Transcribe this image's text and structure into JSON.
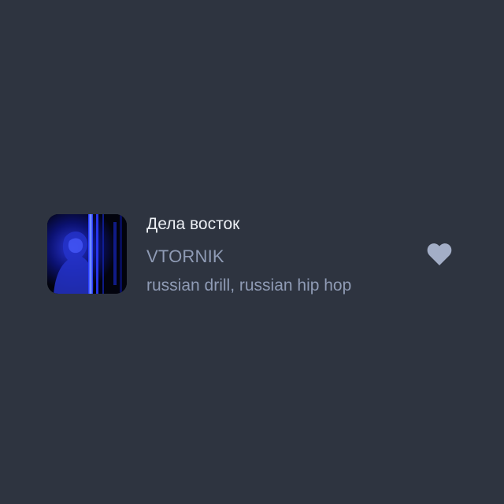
{
  "track": {
    "title": "Дела восток",
    "artist": "VTORNIK",
    "genres": "russian drill, russian hip hop",
    "cover_icon": "album-cover-image",
    "like_icon": "heart-icon",
    "like_color": "#a3aec7"
  },
  "colors": {
    "background": "#2e3440",
    "title": "#eceff4",
    "secondary": "#8f9bb5"
  }
}
